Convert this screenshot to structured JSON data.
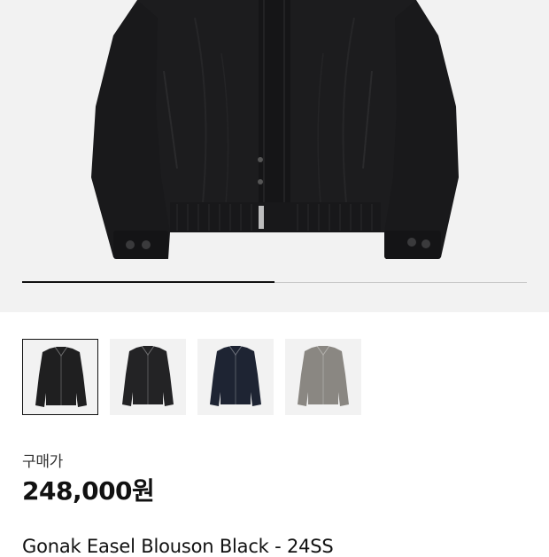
{
  "gallery": {
    "main_image": "jacket-black-front",
    "progress": 0.5,
    "thumbnails": [
      {
        "name": "black-jacket",
        "color": "#1f1f20",
        "selected": true
      },
      {
        "name": "black-jacket-alt",
        "color": "#232325",
        "selected": false
      },
      {
        "name": "navy-jacket",
        "color": "#1e2433",
        "selected": false
      },
      {
        "name": "gray-jacket",
        "color": "#8a8782",
        "selected": false
      }
    ]
  },
  "product": {
    "price_label": "구매가",
    "price": "248,000원",
    "name": "Gonak Easel Blouson Black - 24SS"
  }
}
